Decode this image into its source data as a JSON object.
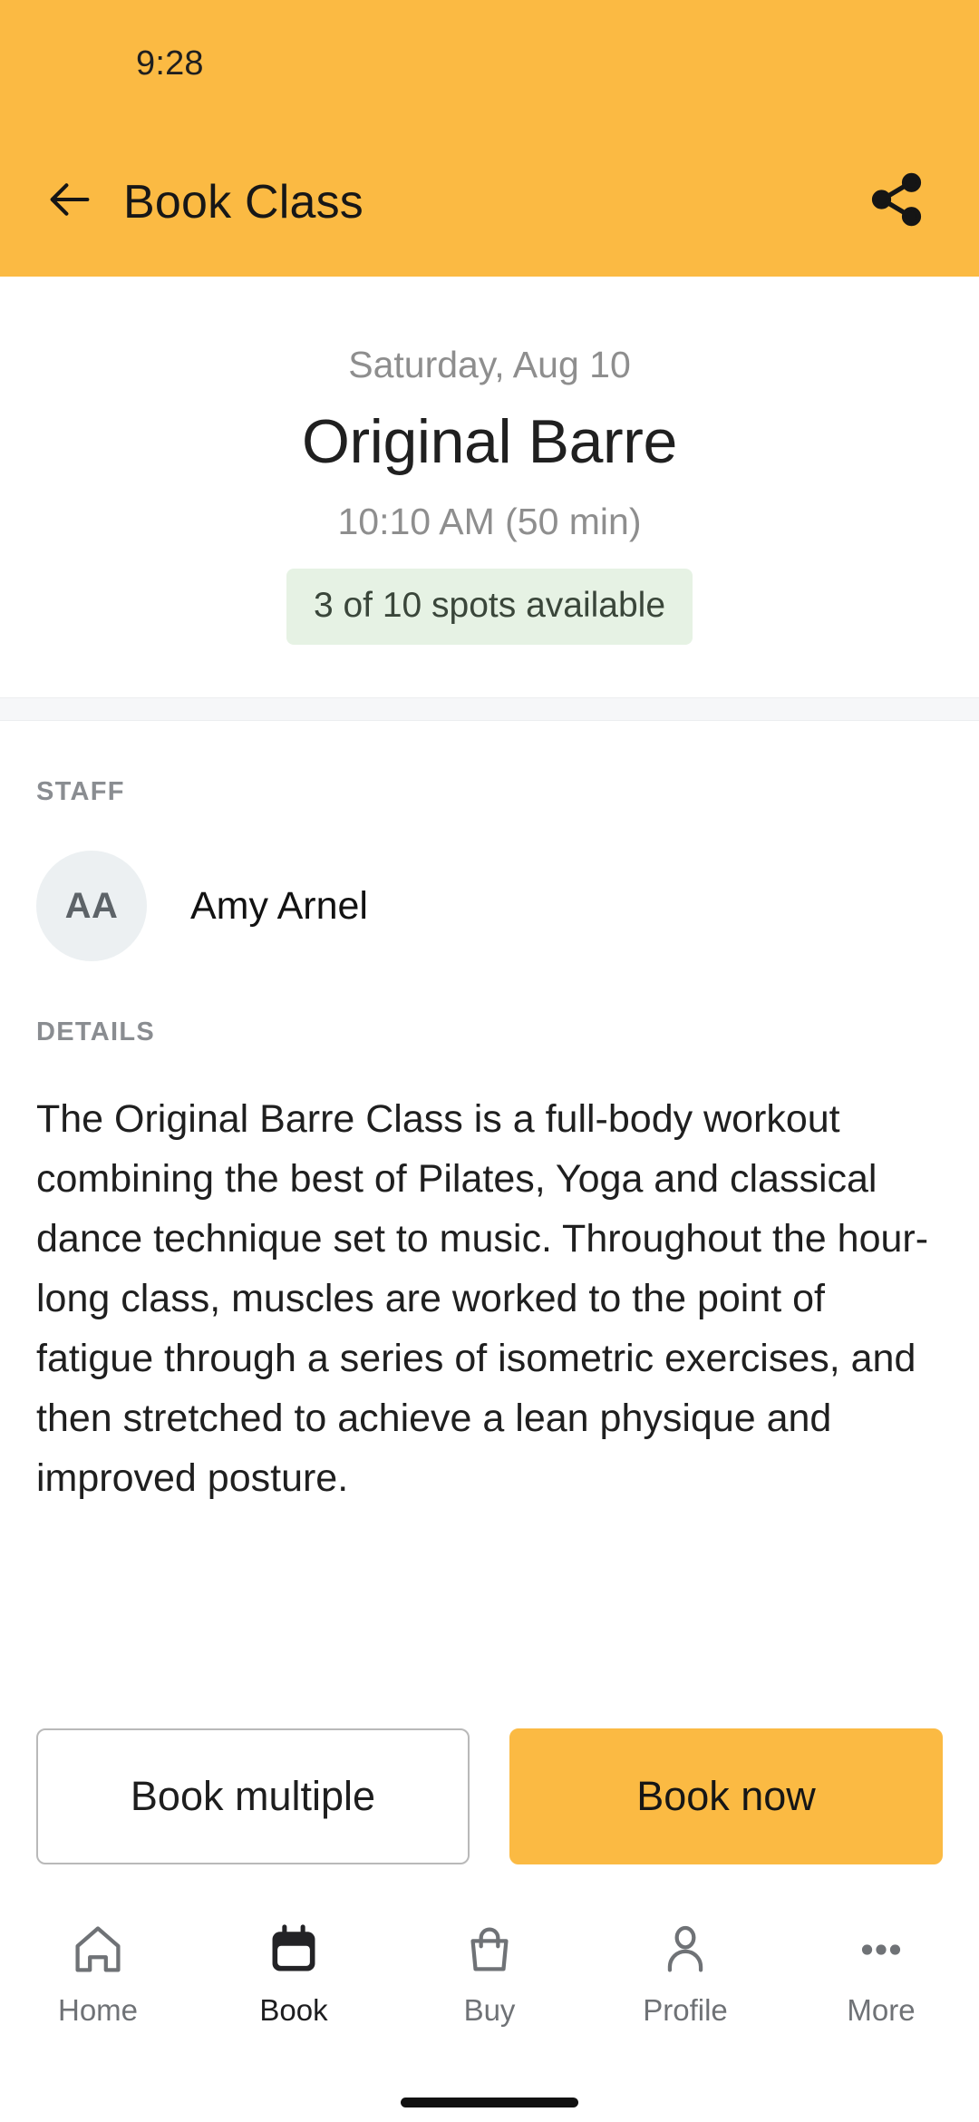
{
  "theme": {
    "accent": "#FBBA43",
    "badge_bg": "#E6F2E4",
    "avatar_bg": "#ECF0F2",
    "divider": "#F6F7F9"
  },
  "status_bar": {
    "time": "9:28"
  },
  "app_bar": {
    "title": "Book Class",
    "back_icon": "arrow-left-icon",
    "share_icon": "share-icon"
  },
  "class_summary": {
    "date": "Saturday, Aug 10",
    "name": "Original Barre",
    "time": "10:10 AM (50 min)",
    "spots": "3 of 10 spots available"
  },
  "staff": {
    "label": "STAFF",
    "members": [
      {
        "initials": "AA",
        "name": "Amy Arnel"
      }
    ]
  },
  "details": {
    "label": "DETAILS",
    "text": "The Original Barre Class is a full-body workout combining the best of Pilates, Yoga and classical dance technique set to music. Throughout the hour-long class, muscles are worked to the point of fatigue through a series of isometric exercises, and then stretched to achieve a lean physique and improved posture."
  },
  "actions": {
    "secondary_label": "Book multiple",
    "primary_label": "Book now"
  },
  "bottom_nav": {
    "items": [
      {
        "label": "Home",
        "icon": "home-icon",
        "active": false
      },
      {
        "label": "Book",
        "icon": "calendar-icon",
        "active": true
      },
      {
        "label": "Buy",
        "icon": "bag-icon",
        "active": false
      },
      {
        "label": "Profile",
        "icon": "person-icon",
        "active": false
      },
      {
        "label": "More",
        "icon": "ellipsis-icon",
        "active": false
      }
    ]
  }
}
